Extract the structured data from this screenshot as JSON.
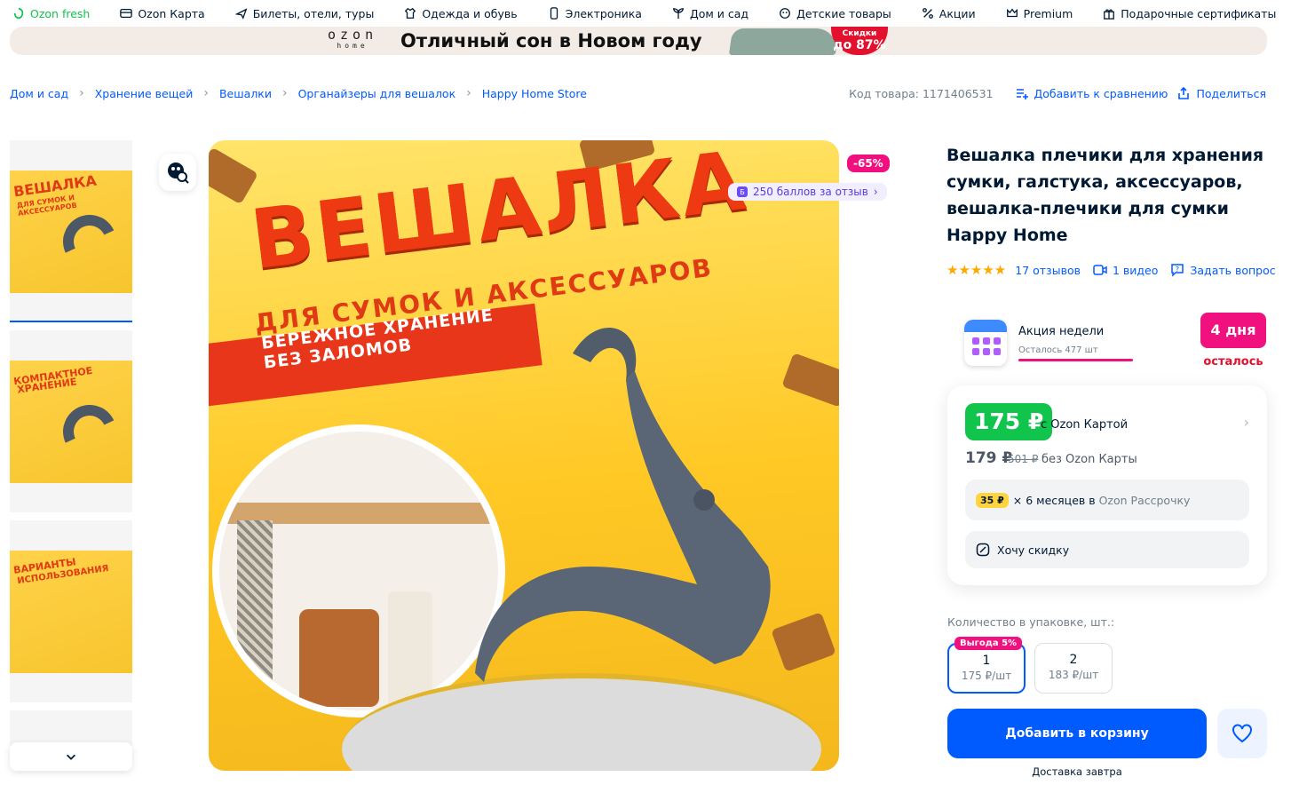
{
  "topnav": {
    "items": [
      {
        "label": "Ozon fresh",
        "icon": "leaf-icon"
      },
      {
        "label": "Ozon Карта",
        "icon": "card-icon"
      },
      {
        "label": "Билеты, отели, туры",
        "icon": "plane-icon"
      },
      {
        "label": "Одежда и обувь",
        "icon": "shirt-icon"
      },
      {
        "label": "Электроника",
        "icon": "phone-icon"
      },
      {
        "label": "Дом и сад",
        "icon": "plant-icon"
      },
      {
        "label": "Детские товары",
        "icon": "baby-icon"
      },
      {
        "label": "Акции",
        "icon": "percent-icon"
      },
      {
        "label": "Premium",
        "icon": "crown-icon"
      },
      {
        "label": "Подарочные сертификаты",
        "icon": "gift-icon"
      }
    ]
  },
  "banner": {
    "logo_top": "ozon",
    "logo_bottom": "home",
    "text": "Отличный сон в Новом году",
    "sale_top": "Скидки",
    "sale_value": "до 87%"
  },
  "breadcrumbs": [
    "Дом и сад",
    "Хранение вещей",
    "Вешалки",
    "Органайзеры для вешалок",
    "Happy Home Store"
  ],
  "meta": {
    "code": "Код товара: 1171406531",
    "compare": "Добавить к сравнению",
    "share": "Поделиться"
  },
  "gallery": {
    "thumbs": [
      {
        "t1": "ВЕШАЛКА",
        "t2": "ДЛЯ СУМОК И АКСЕССУАРОВ"
      },
      {
        "t1": "КОМПАКТНОЕ",
        "t2": "ХРАНЕНИЕ"
      },
      {
        "t1": "ВАРИАНТЫ",
        "t2": "ИСПОЛЬЗОВАНИЯ"
      }
    ],
    "main": {
      "h1": "ВЕШАЛКА",
      "h2": "ДЛЯ СУМОК И АКСЕССУАРОВ",
      "h3a": "БЕРЕЖНОЕ ХРАНЕНИЕ",
      "h3b": "БЕЗ ЗАЛОМОВ"
    },
    "discount": "-65%",
    "points_badge": "Б",
    "points": "250 баллов за отзыв"
  },
  "product": {
    "title": "Вешалка плечики для хранения сумки, галстука, аксессуаров, вешалка-плечики для сумки Happy Home",
    "rating": 5,
    "reviews": "17 отзывов",
    "videos": "1 видео",
    "ask": "Задать вопрос"
  },
  "promo": {
    "name": "Акция недели",
    "left": "Осталось 477 шт",
    "remaining_fraction": 0.95,
    "days": "4 дня",
    "days_label": "осталось"
  },
  "price": {
    "card_price": "175 ₽",
    "card_label": "с Ozon Картой",
    "regular": "179 ₽",
    "old": "501 ₽",
    "regular_label": "без Ozon Карты",
    "installment_amount": "35 ₽",
    "installment_text": "× 6 месяцев в",
    "installment_brand": "Ozon Рассрочку",
    "want_discount": "Хочу скидку"
  },
  "quantity": {
    "label": "Количество в упаковке, шт.:",
    "options": [
      {
        "n": "1",
        "price": "175 ₽/шт",
        "tag": "Выгода 5%"
      },
      {
        "n": "2",
        "price": "183 ₽/шт"
      }
    ]
  },
  "actions": {
    "cart": "Добавить в корзину",
    "delivery": "Доставка завтра"
  },
  "colors": {
    "accent": "#005bff",
    "green": "#10c44c",
    "pink": "#f1117e"
  }
}
